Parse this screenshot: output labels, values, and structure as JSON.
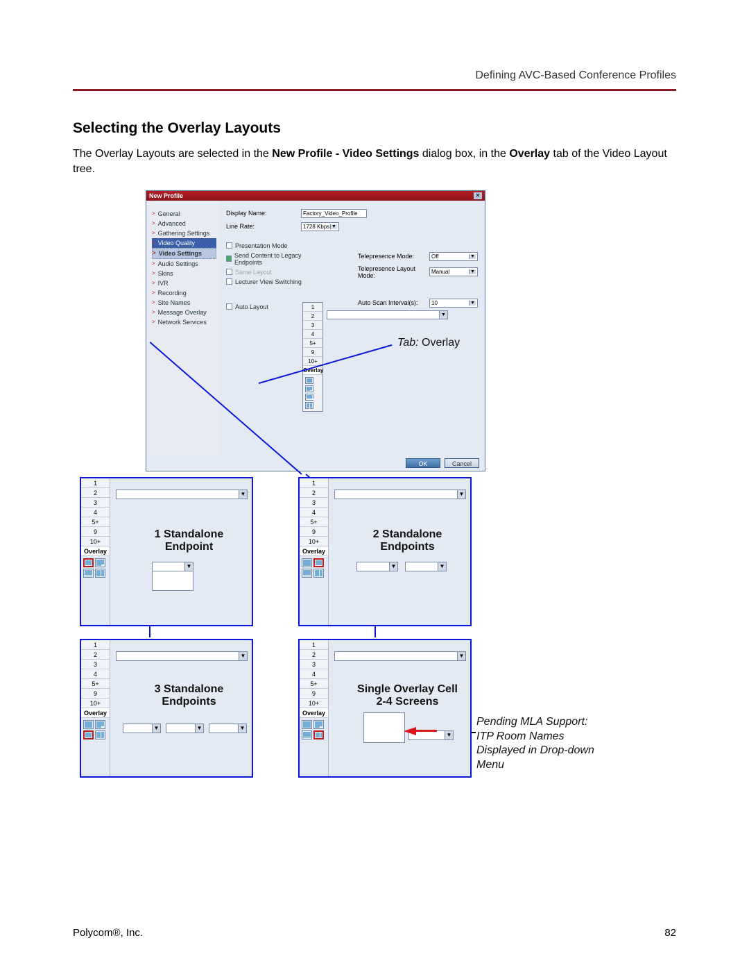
{
  "header_right": "Defining AVC-Based Conference Profiles",
  "section_title": "Selecting the Overlay Layouts",
  "body_pre": "The Overlay Layouts are selected in the ",
  "body_bold1": "New Profile - Video Settings",
  "body_mid1": " dialog box, in the ",
  "body_bold2": "Overlay",
  "body_mid2": " tab of the Video Layout tree.",
  "dialog": {
    "title": "New Profile",
    "nav": [
      "General",
      "Advanced",
      "Gathering Settings",
      "Video Quality",
      "Video Settings",
      "Audio Settings",
      "Skins",
      "IVR",
      "Recording",
      "Site Names",
      "Message Overlay",
      "Network Services"
    ],
    "rows": {
      "display_name_label": "Display Name:",
      "display_name_value": "Factory_Video_Profile",
      "line_rate_label": "Line Rate:",
      "line_rate_value": "1728 Kbps"
    },
    "checks": {
      "presentation": "Presentation Mode",
      "send_content": "Send Content to Legacy Endpoints",
      "same_layout": "Same Layout",
      "lecturer": "Lecturer View Switching",
      "auto_layout": "Auto Layout"
    },
    "right_fields": {
      "telepresence_mode_label": "Telepresence Mode:",
      "telepresence_mode_value": "Off",
      "telepresence_layout_label": "Telepresence Layout Mode:",
      "telepresence_layout_value": "Manual",
      "auto_scan_label": "Auto Scan Interval(s):",
      "auto_scan_value": "10"
    },
    "tabs": [
      "1",
      "2",
      "3",
      "4",
      "5+",
      "9",
      "10+",
      "Overlay"
    ],
    "ok": "OK",
    "cancel": "Cancel"
  },
  "tab_callout_label_prefix": "Tab: ",
  "tab_callout_label_value": "Overlay",
  "panel_tabs": [
    "1",
    "2",
    "3",
    "4",
    "5+",
    "9",
    "10+",
    "Overlay"
  ],
  "panels": {
    "p1": "1 Standalone\nEndpoint",
    "p2": "2 Standalone\nEndpoints",
    "p3": "3 Standalone\nEndpoints",
    "p4": "Single Overlay Cell\n2-4 Screens"
  },
  "pending_note": "Pending MLA Support:\nITP Room Names Displayed in Drop-down Menu",
  "footer_left": "Polycom®, Inc.",
  "footer_right": "82"
}
